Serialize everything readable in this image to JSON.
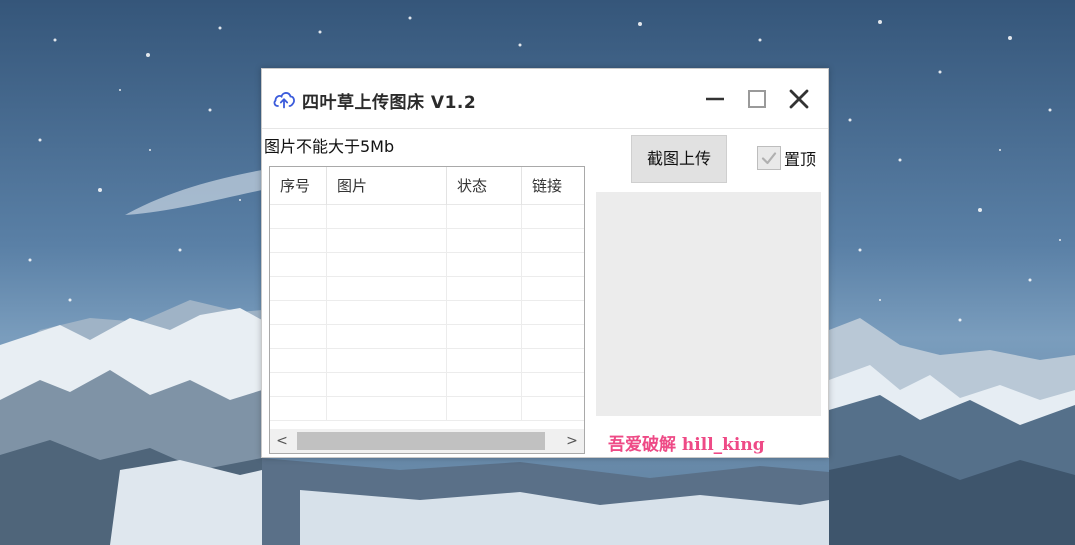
{
  "window": {
    "title": "四叶草上传图床 V1.2",
    "icon": "cloud-upload-icon",
    "controls": [
      "minimize-icon",
      "maximize-icon",
      "close-icon"
    ]
  },
  "size_note": "图片不能大于5Mb",
  "listview": {
    "columns": [
      "序号",
      "图片",
      "状态",
      "链接"
    ],
    "rows": [],
    "scroll_left": "<",
    "scroll_right": ">"
  },
  "capture_button": "截图上传",
  "topmost": {
    "label": "置顶",
    "checked": true
  },
  "credit": "吾爱破解 hill_king",
  "colors": {
    "accent_icon": "#3b5bdb",
    "credit": "#ee4a86",
    "preview_bg": "#ececec"
  }
}
